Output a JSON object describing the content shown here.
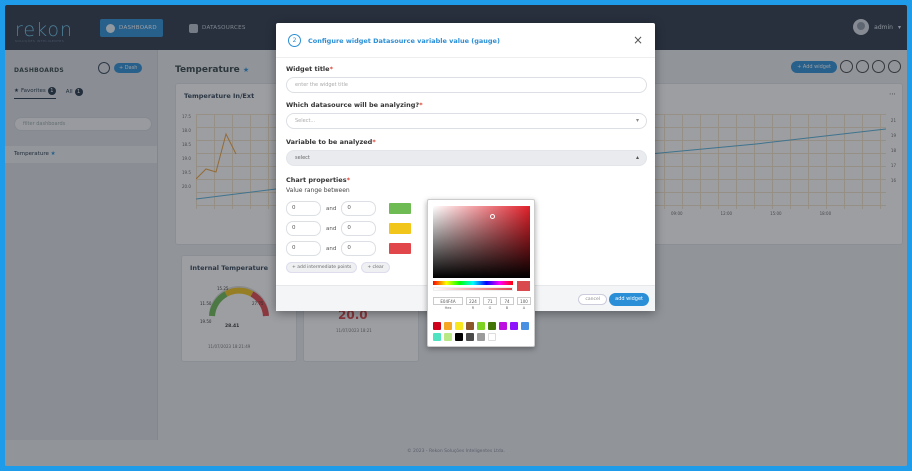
{
  "app": {
    "logo": "rekon",
    "logo_sub": "SOLUÇÕES INTELIGENTES",
    "nav": [
      {
        "label": "DASHBOARD",
        "icon": "dashboard-icon",
        "active": true
      },
      {
        "label": "DATASOURCES",
        "icon": "database-icon",
        "active": false
      }
    ],
    "user": "admin"
  },
  "sidebar": {
    "title": "DASHBOARDS",
    "new_label": "+ Dash",
    "tabs": [
      {
        "label": "Favorites",
        "count": "1"
      },
      {
        "label": "All",
        "count": "1"
      }
    ],
    "search_placeholder": "filter dashboards",
    "items": [
      {
        "label": "Temperature",
        "star": "★"
      }
    ]
  },
  "main": {
    "title": "Temperature",
    "title_star": "★",
    "add_widget": "+ Add widget",
    "chart_panel_title": "Temperature In/Ext",
    "gauge_panel_title": "Internal Temperature",
    "chart_y_ticks": [
      "17.5",
      "18.0",
      "18.5",
      "19.0",
      "19.5",
      "20.0"
    ],
    "chart_x_ticks": [
      "09:00",
      "12:00",
      "15:00",
      "18:00"
    ],
    "chart_y2_ticks": [
      "21",
      "19",
      "18",
      "17",
      "16"
    ],
    "gauge_labels": [
      "15.25",
      "11.50",
      "27.75",
      "19.50",
      "28.41"
    ],
    "gauge_date": "11/07/2023 18:21:49",
    "second_value": "20.0",
    "second_date": "11/07/2023 18:21",
    "footer": "© 2023 - Rekon Soluções Inteligentes Ltda."
  },
  "modal": {
    "step": "2",
    "title": "Configure widget Datasource variable value (gauge)",
    "close": "×",
    "widget_title_label": "Widget title",
    "widget_title_placeholder": "enter the widget title",
    "datasource_label": "Which datasource will be analyzing?",
    "datasource_placeholder": "Select...",
    "variable_label": "Variable to be analyzed",
    "variable_value": "select",
    "chart_props_label": "Chart properties",
    "range_label": "Value range between",
    "and_label": "and",
    "ranges": [
      {
        "from": "0",
        "to": "0",
        "color": "#6dbb52"
      },
      {
        "from": "0",
        "to": "0",
        "color": "#f2c51b"
      },
      {
        "from": "0",
        "to": "0",
        "color": "#e0464a"
      }
    ],
    "add_range_label": "+ add intermediate points",
    "clear_label": "+ clear",
    "cancel_label": "cancel",
    "submit_label": "add widget"
  },
  "color_picker": {
    "hex": "E04F4A",
    "r": "224",
    "g": "71",
    "b": "74",
    "a": "100",
    "captions": [
      "Hex",
      "R",
      "G",
      "B",
      "A"
    ],
    "swatches": [
      "#d0021b",
      "#f5a623",
      "#f8e71c",
      "#8b572a",
      "#7ed321",
      "#417505",
      "#bd10e0",
      "#9013fe",
      "#4a90e2",
      "#50e3c2",
      "#b8e986",
      "#000000",
      "#4a4a4a",
      "#9b9b9b",
      "#ffffff"
    ]
  }
}
